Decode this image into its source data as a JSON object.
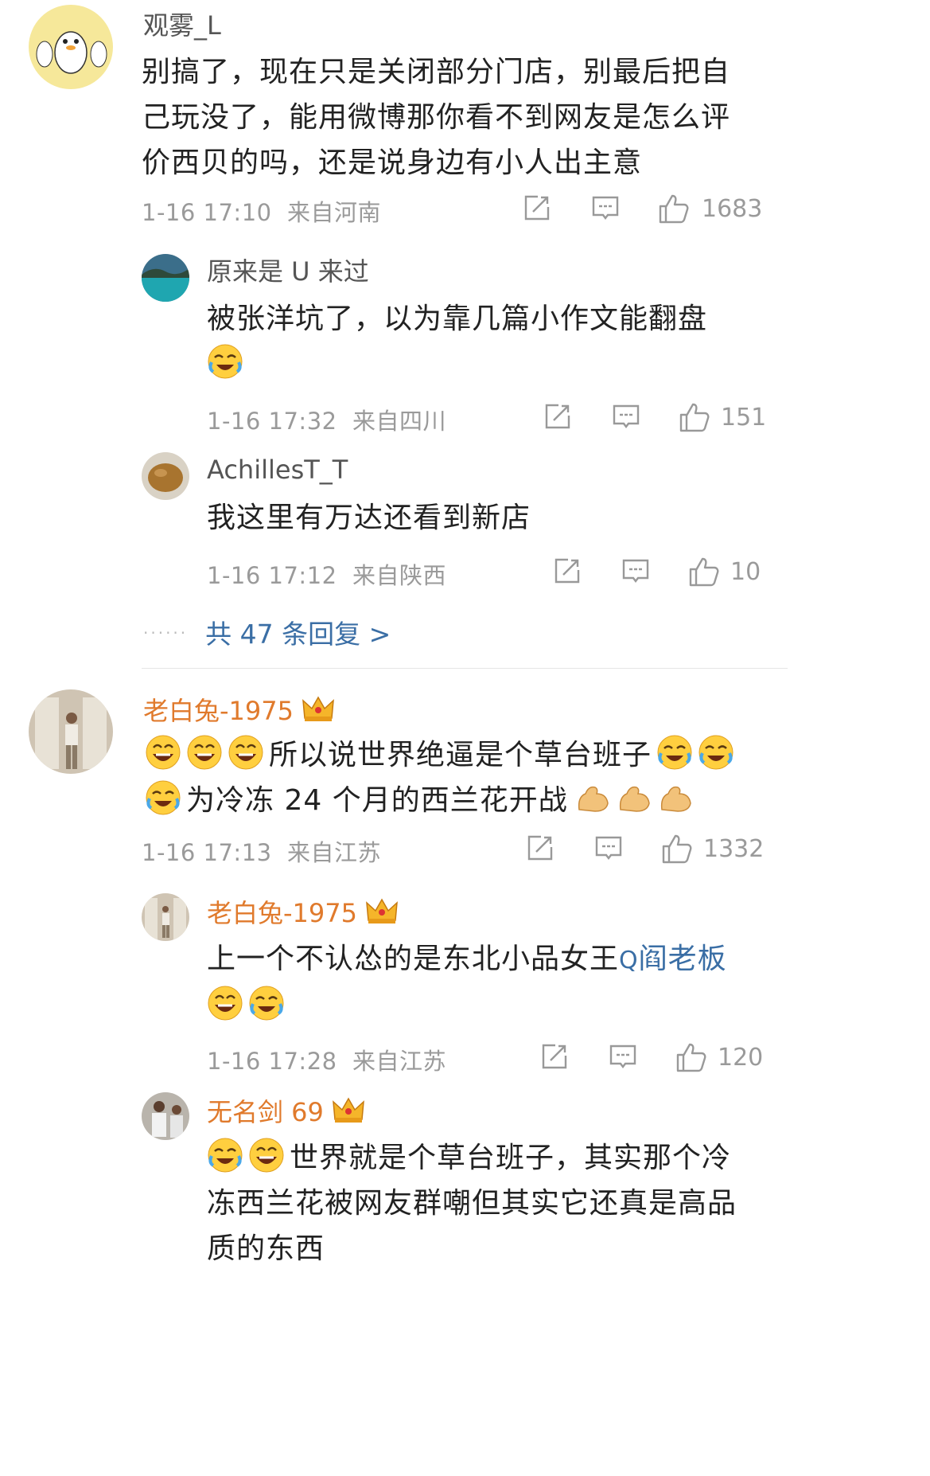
{
  "comments": [
    {
      "user": "观雾_L",
      "text": "别搞了，现在只是关闭部分门店，别最后把自己玩没了，能用微博那你看不到网友是怎么评价西贝的吗，还是说身边有小人出主意",
      "time": "1-16 17:10",
      "location": "来自河南",
      "likes": "1683",
      "replies": [
        {
          "user": "原来是 U 来过",
          "text": "被张洋坑了，以为靠几篇小作文能翻盘",
          "emoji_after": [
            "cry-laugh"
          ],
          "time": "1-16 17:32",
          "location": "来自四川",
          "likes": "151"
        },
        {
          "user": "AchillesT_T",
          "text": "我这里有万达还看到新店",
          "time": "1-16 17:12",
          "location": "来自陕西",
          "likes": "10"
        }
      ],
      "more_replies": "共 47 条回复 >"
    },
    {
      "user": "老白兔-1975",
      "user_badge": "crown-icon",
      "text_line1": "所以说世界绝逼是个草台班子",
      "text_line2": "为冷冻 24 个月的西兰花开战",
      "time": "1-16 17:13",
      "location": "来自江苏",
      "likes": "1332",
      "replies": [
        {
          "user": "老白兔-1975",
          "text": "上一个不认怂的是东北小品女王",
          "link": "阎老板",
          "time": "1-16 17:28",
          "location": "来自江苏",
          "likes": "120"
        },
        {
          "user": "无名剑 69",
          "text": "世界就是个草台班子，其实那个冷冻西兰花被网友群嘲但其实它还真是高品质的东西"
        }
      ]
    }
  ],
  "colors": {
    "link": "#3a6ea5",
    "vip_name": "#e07a2c",
    "meta": "#9a9a9a"
  }
}
